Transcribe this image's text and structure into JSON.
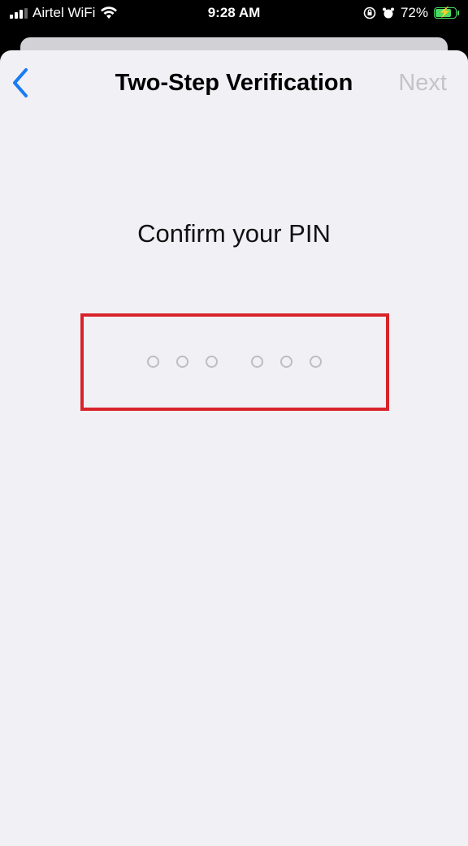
{
  "status_bar": {
    "carrier": "Airtel WiFi",
    "time": "9:28 AM",
    "battery_percent": "72%",
    "icons": [
      "signal-icon",
      "wifi-icon",
      "orientation-lock-icon",
      "alarm-icon",
      "battery-charging-icon"
    ]
  },
  "navbar": {
    "back_icon": "chevron-left-icon",
    "title": "Two-Step Verification",
    "next_label": "Next"
  },
  "main": {
    "prompt": "Confirm your PIN",
    "pin_length": 6,
    "pin_filled": 0
  },
  "colors": {
    "accent": "#1a7cf2",
    "highlight_border": "#d8232a",
    "next_disabled": "#c4c4c6",
    "background": "#f1f0f5"
  }
}
